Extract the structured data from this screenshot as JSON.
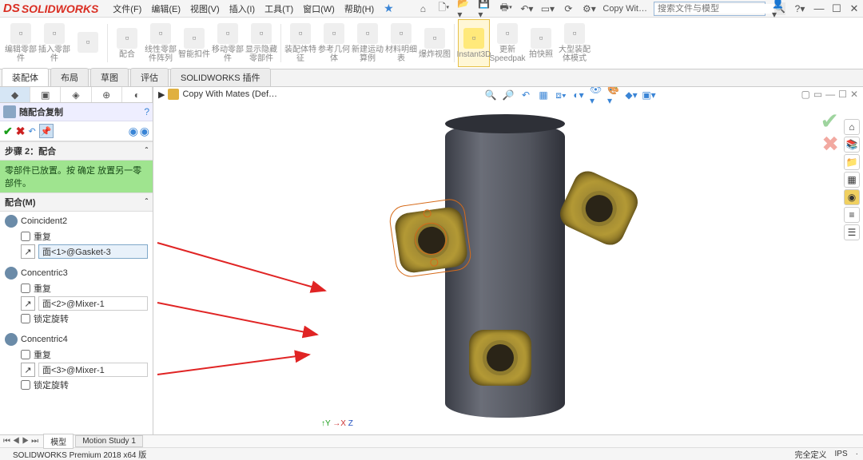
{
  "app": {
    "logo_text": "SOLIDWORKS",
    "logo_prefix": "DS"
  },
  "menus": [
    "文件(F)",
    "编辑(E)",
    "视图(V)",
    "插入(I)",
    "工具(T)",
    "窗口(W)",
    "帮助(H)"
  ],
  "titlebar": {
    "doc_label": "Copy Wit…",
    "search_placeholder": "搜索文件与模型"
  },
  "ribbon": {
    "items": [
      {
        "label": "编辑零部件"
      },
      {
        "label": "插入零部件"
      },
      {
        "label": ""
      },
      {
        "label": "配合"
      },
      {
        "label": "线性零部件阵列"
      },
      {
        "label": "智能扣件"
      },
      {
        "label": "移动零部件"
      },
      {
        "label": "显示隐藏零部件"
      },
      {
        "label": "装配体特征"
      },
      {
        "label": "参考几何体"
      },
      {
        "label": "新建运动算例"
      },
      {
        "label": "材料明细表"
      },
      {
        "label": "爆炸视图"
      },
      {
        "label": "Instant3D"
      },
      {
        "label": "更新Speedpak"
      },
      {
        "label": "拍快照"
      },
      {
        "label": "大型装配体模式"
      }
    ],
    "active_index": 13
  },
  "tabs": {
    "items": [
      "装配体",
      "布局",
      "草图",
      "评估",
      "SOLIDWORKS 插件"
    ],
    "selected": 0
  },
  "breadcrumb": {
    "doc": "Copy With Mates  (Def…"
  },
  "panel": {
    "title": "随配合复制",
    "step_label": "步骤 2：配合",
    "info": "零部件已放置。按 确定 放置另一零部件。",
    "mates_header": "配合(M)",
    "mates": [
      {
        "name": "Coincident2",
        "repeat_label": "重复",
        "field": "面<1>@Gasket-3",
        "lock_label": "",
        "highlight": true
      },
      {
        "name": "Concentric3",
        "repeat_label": "重复",
        "field": "面<2>@Mixer-1",
        "lock_label": "锁定旋转",
        "highlight": false
      },
      {
        "name": "Concentric4",
        "repeat_label": "重复",
        "field": "面<3>@Mixer-1",
        "lock_label": "锁定旋转",
        "highlight": false
      }
    ]
  },
  "bottom_tabs": {
    "items": [
      "模型",
      "Motion Study 1"
    ],
    "selected": 0
  },
  "status": {
    "left": "SOLIDWORKS Premium 2018 x64 版",
    "right1": "完全定义",
    "right2": "IPS",
    "right3": "·"
  }
}
